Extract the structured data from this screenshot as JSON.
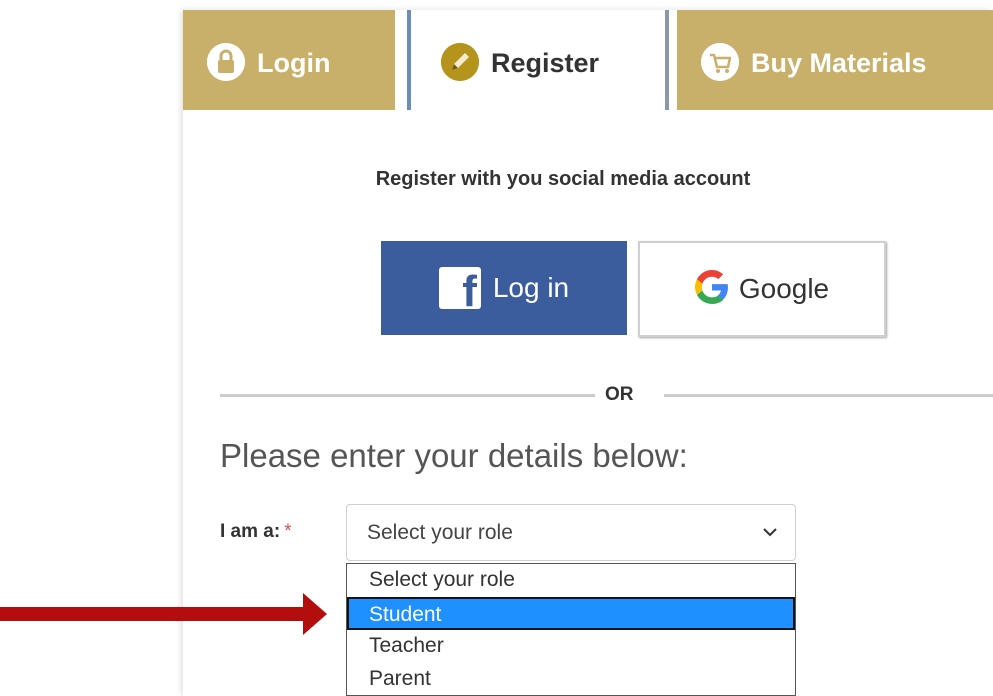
{
  "tabs": [
    {
      "label": "Login",
      "icon": "lock-icon"
    },
    {
      "label": "Register",
      "icon": "pencil-icon"
    },
    {
      "label": "Buy Materials",
      "icon": "cart-icon"
    }
  ],
  "social": {
    "title": "Register with you social media account",
    "facebook_label": "Log in",
    "google_label": "Google"
  },
  "divider": {
    "text": "OR"
  },
  "form": {
    "heading": "Please enter your details below:",
    "role_label": "I am a:",
    "required_mark": "*",
    "role_select": {
      "value": "Select your role",
      "options": [
        "Select your role",
        "Student",
        "Teacher",
        "Parent"
      ],
      "highlighted": "Student"
    }
  },
  "colors": {
    "tab_bg": "#c8b06a",
    "facebook": "#3b5d9d",
    "highlight": "#1e90ff",
    "arrow": "#b40d0d"
  }
}
